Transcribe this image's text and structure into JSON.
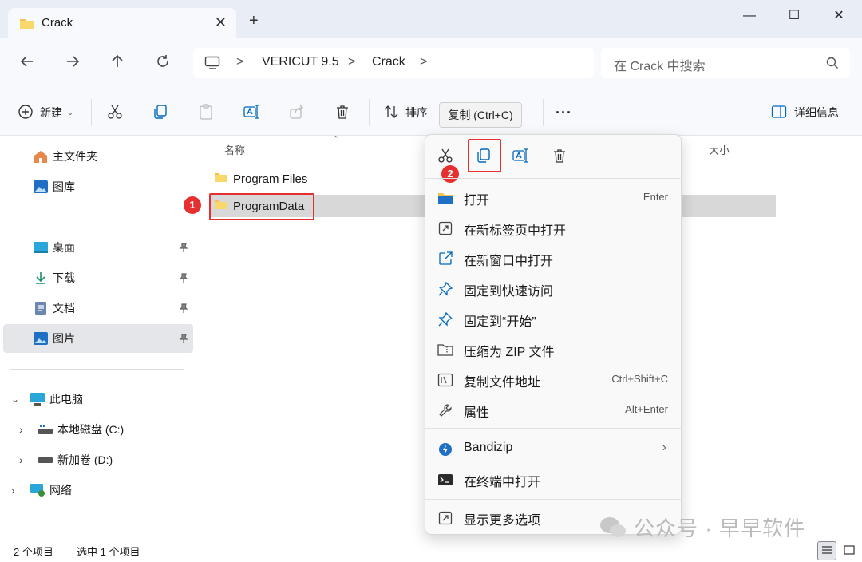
{
  "window": {
    "tab_title": "Crack",
    "new_tab": "+",
    "minimize": "—",
    "maximize": "☐",
    "close": "✕"
  },
  "address": {
    "crumbs": [
      "VERICUT 9.5",
      "Crack"
    ],
    "separator": ">",
    "search_placeholder": "在 Crack 中搜索"
  },
  "commandbar": {
    "new_label": "新建",
    "sort_label": "排序",
    "details_label": "详细信息",
    "more": "···"
  },
  "tooltip": "复制 (Ctrl+C)",
  "sidebar": {
    "items": [
      {
        "label": "主文件夹",
        "icon": "home-icon"
      },
      {
        "label": "图库",
        "icon": "gallery-icon"
      },
      {
        "label": "桌面",
        "icon": "desktop-icon"
      },
      {
        "label": "下载",
        "icon": "download-icon"
      },
      {
        "label": "文档",
        "icon": "document-icon"
      },
      {
        "label": "图片",
        "icon": "pictures-icon"
      },
      {
        "label": "此电脑",
        "icon": "this-pc-icon"
      },
      {
        "label": "本地磁盘 (C:)",
        "icon": "drive-icon"
      },
      {
        "label": "新加卷 (D:)",
        "icon": "drive-icon"
      },
      {
        "label": "网络",
        "icon": "network-icon"
      }
    ]
  },
  "content": {
    "col_name": "名称",
    "col_size": "大小",
    "files": [
      "Program Files",
      "ProgramData"
    ],
    "badge1": "1",
    "badge2": "2"
  },
  "context_menu": {
    "items": [
      {
        "label": "打开",
        "shortcut": "Enter"
      },
      {
        "label": "在新标签页中打开",
        "shortcut": ""
      },
      {
        "label": "在新窗口中打开",
        "shortcut": ""
      },
      {
        "label": "固定到快速访问",
        "shortcut": ""
      },
      {
        "label": "固定到“开始”",
        "shortcut": ""
      },
      {
        "label": "压缩为 ZIP 文件",
        "shortcut": ""
      },
      {
        "label": "复制文件地址",
        "shortcut": "Ctrl+Shift+C"
      },
      {
        "label": "属性",
        "shortcut": "Alt+Enter"
      },
      {
        "label": "Bandizip",
        "shortcut": ""
      },
      {
        "label": "在终端中打开",
        "shortcut": ""
      },
      {
        "label": "显示更多选项",
        "shortcut": ""
      }
    ]
  },
  "status": {
    "count": "2 个项目",
    "selected": "选中 1 个项目"
  },
  "watermark": "公众号 · 早早软件",
  "colors": {
    "accent": "#0067c0",
    "folder": "#f2c14e",
    "highlight_red": "#e5302f"
  }
}
